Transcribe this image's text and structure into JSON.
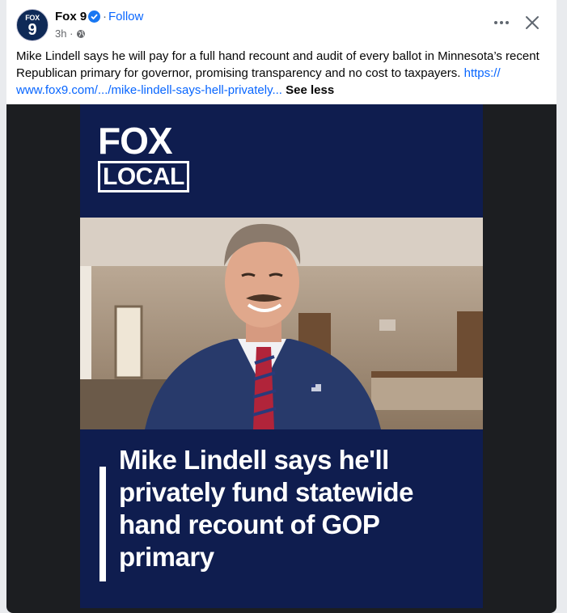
{
  "post": {
    "page_name": "Fox 9",
    "avatar_text_small": "FOX",
    "avatar_text_big": "9",
    "follow_label": "Follow",
    "separator": "·",
    "time": "3h ·",
    "caption_text": "Mike Lindell says he will pay for a full hand recount and audit of every ballot in Minnesota’s recent Republican primary for governor, promising transparency and no cost to taxpayers. ",
    "link_text": "https:// www.fox9.com/.../mike-lindell-says-hell-privately...",
    "see_less": "See less"
  },
  "media": {
    "logo_top": "FOX",
    "logo_bottom": "LOCAL",
    "headline": "Mike Lindell says he'll privately fund statewide hand recount of GOP primary"
  },
  "icons": {
    "verified": "verified-badge-icon",
    "globe": "globe-icon",
    "more": "more-options-icon",
    "close": "close-icon"
  },
  "colors": {
    "accent": "#0866ff",
    "video_bg": "#0f1d4f",
    "media_bg": "#1c1e21"
  }
}
